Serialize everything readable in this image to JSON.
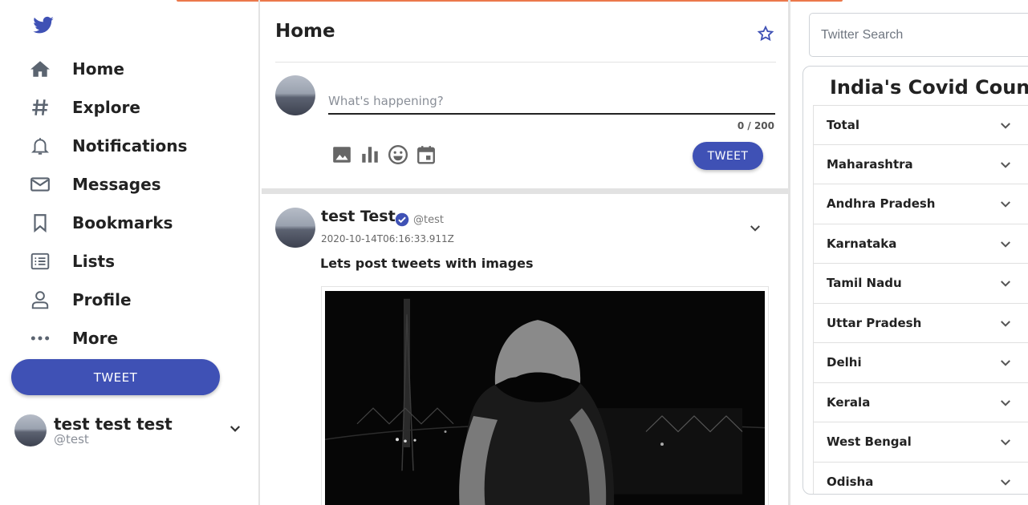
{
  "colors": {
    "accent": "#3f51b5",
    "verified": "#3f51b5",
    "toast": "#e8602c"
  },
  "sidebar": {
    "logo_icon": "twitter-bird-icon",
    "items": [
      {
        "label": "Home",
        "icon": "home-icon"
      },
      {
        "label": "Explore",
        "icon": "hash-icon"
      },
      {
        "label": "Notifications",
        "icon": "bell-icon"
      },
      {
        "label": "Messages",
        "icon": "mail-icon"
      },
      {
        "label": "Bookmarks",
        "icon": "bookmark-icon"
      },
      {
        "label": "Lists",
        "icon": "list-icon"
      },
      {
        "label": "Profile",
        "icon": "person-icon"
      },
      {
        "label": "More",
        "icon": "more-icon"
      }
    ],
    "tweet_button": "TWEET",
    "profile": {
      "name": "test test test",
      "handle": "@test"
    }
  },
  "home": {
    "title": "Home",
    "composer": {
      "placeholder": "What's happening?",
      "char_count": "0 / 200",
      "tweet_button": "TWEET"
    },
    "post": {
      "name": "test Test",
      "handle": "@test",
      "timestamp": "2020-10-14T06:16:33.911Z",
      "text": "Lets post tweets with images"
    }
  },
  "search": {
    "placeholder": "Twitter Search"
  },
  "covid": {
    "title": "India's Covid Count",
    "rows": [
      "Total",
      "Maharashtra",
      "Andhra Pradesh",
      "Karnataka",
      "Tamil Nadu",
      "Uttar Pradesh",
      "Delhi",
      "Kerala",
      "West Bengal",
      "Odisha"
    ]
  }
}
